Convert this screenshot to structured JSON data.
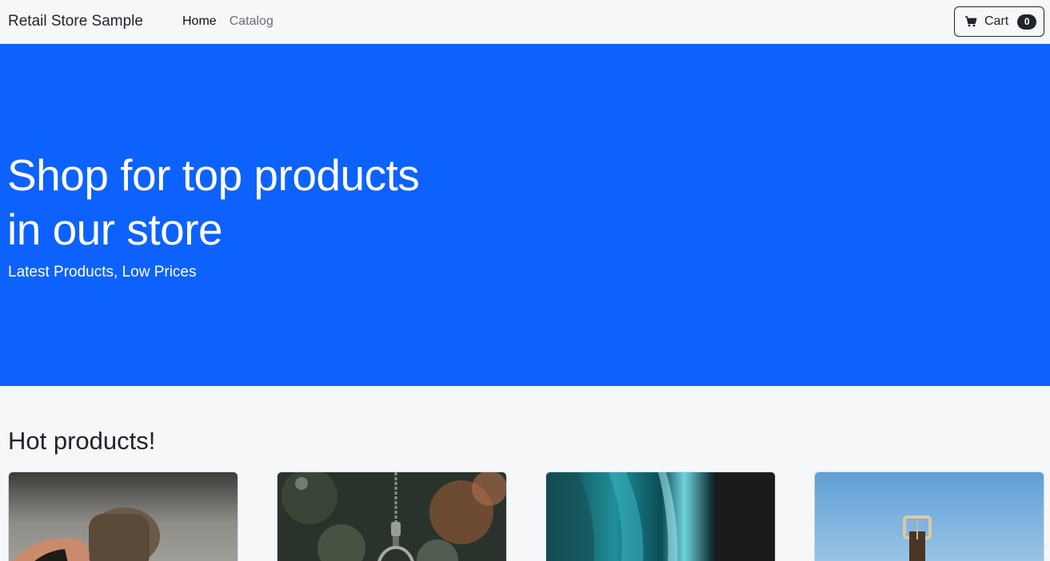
{
  "navbar": {
    "brand": "Retail Store Sample",
    "links": [
      {
        "label": "Home",
        "active": true
      },
      {
        "label": "Catalog",
        "active": false
      }
    ],
    "cart": {
      "label": "Cart",
      "count": "0",
      "icon": "cart-icon"
    }
  },
  "hero": {
    "title": "Shop for top products in our store",
    "subtitle": "Latest Products, Low Prices",
    "background": "#0d62fd"
  },
  "products_section": {
    "title": "Hot products!",
    "cards": [
      {
        "image": "hand-holding-brown-object"
      },
      {
        "image": "silver-chain-keyring"
      },
      {
        "image": "teal-textured-fabric"
      },
      {
        "image": "watch-strap-with-buckle-sky"
      }
    ]
  }
}
